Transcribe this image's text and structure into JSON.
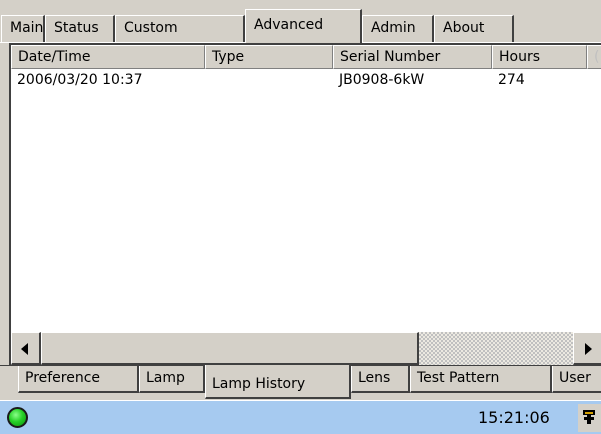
{
  "top_tabs": [
    {
      "label": "Main"
    },
    {
      "label": "Status"
    },
    {
      "label": "Custom"
    },
    {
      "label": "Advanced",
      "active": true
    },
    {
      "label": "Admin"
    },
    {
      "label": "About"
    }
  ],
  "lamp_history": {
    "columns": [
      "Date/Time",
      "Type",
      "Serial Number",
      "Hours",
      "("
    ],
    "rows": [
      {
        "datetime": "2006/03/20 10:37",
        "type": "",
        "serial": "JB0908-6kW",
        "hours": "274"
      }
    ]
  },
  "bottom_tabs": [
    {
      "label": "Preference"
    },
    {
      "label": "Lamp"
    },
    {
      "label": "Lamp History",
      "active": true
    },
    {
      "label": "Lens"
    },
    {
      "label": "Test Pattern"
    },
    {
      "label": "User"
    }
  ],
  "status_bar": {
    "indicator_color": "#27d127",
    "time": "15:21:06",
    "tray_icon": "tools-icon"
  },
  "colors": {
    "face": "#d4d0c8",
    "status_bar": "#a6caf0",
    "list_bg": "#ffffff"
  }
}
